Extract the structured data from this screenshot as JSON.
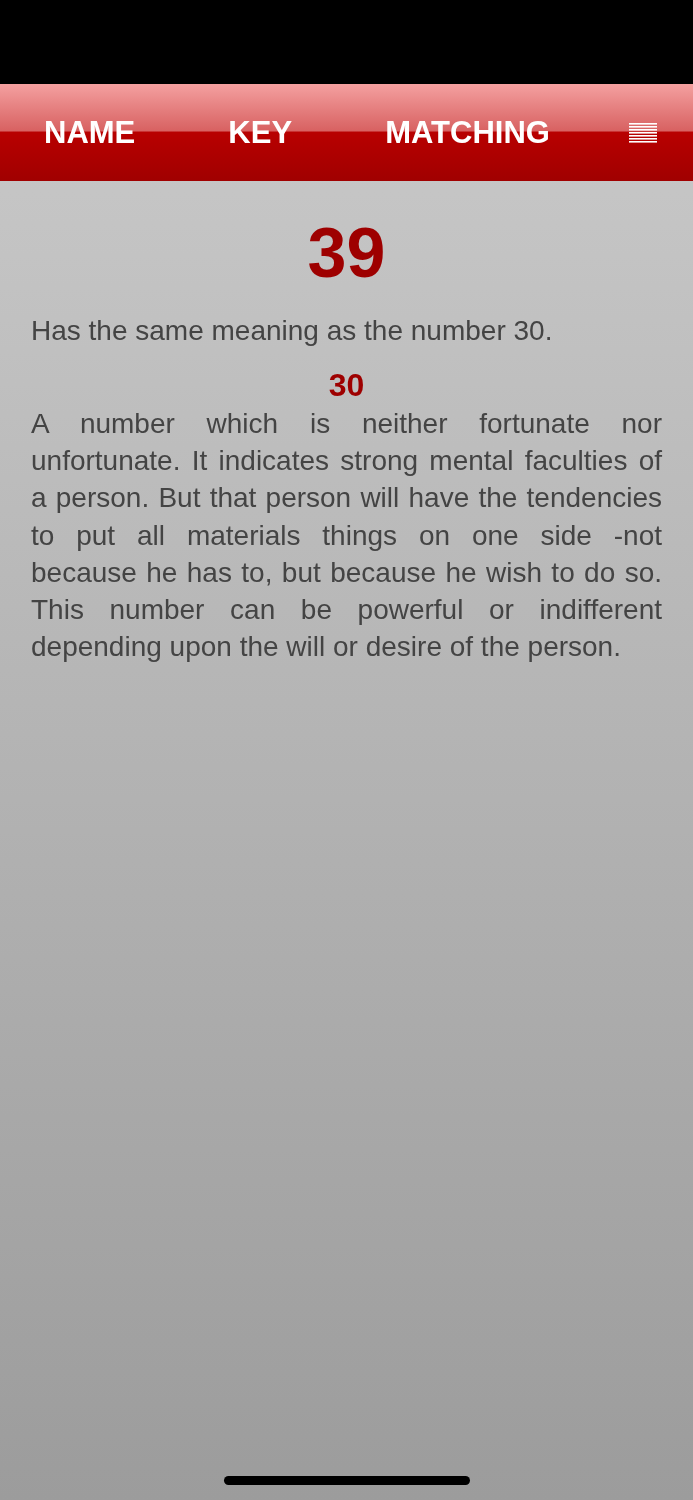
{
  "nav_bar": {
    "tabs": [
      {
        "label": "NAME"
      },
      {
        "label": "KEY"
      },
      {
        "label": "MATCHING"
      }
    ]
  },
  "entry": {
    "number": "39",
    "summary": "Has the same meaning as the number 30.",
    "reference_number": "30",
    "description": "A number which is neither fortunate nor unfortunate. It indicates strong mental faculties of a person. But that person will have the tendencies to put all materials things on one side -not because he has to, but because he wish to do so. This number can be powerful or indifferent depending upon the will or desire of the person."
  }
}
